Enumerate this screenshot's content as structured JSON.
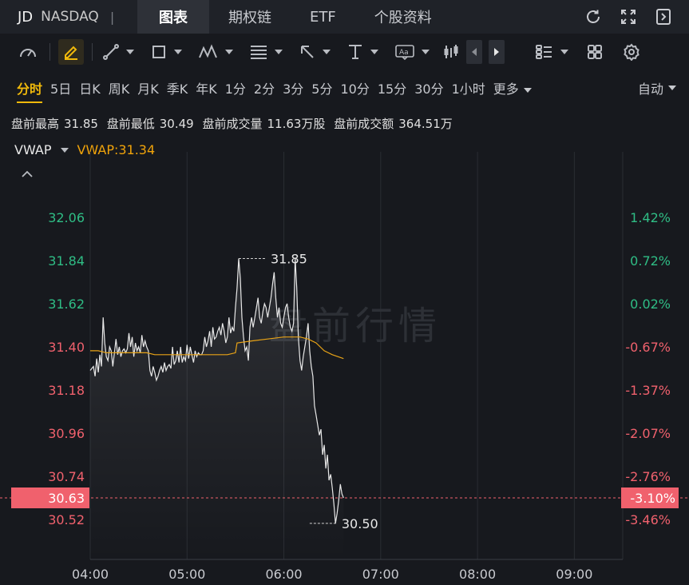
{
  "ticker": {
    "symbol": "JD",
    "exchange": "NASDAQ",
    "separator": "|"
  },
  "tabs": [
    {
      "label": "图表",
      "active": true
    },
    {
      "label": "期权链",
      "active": false
    },
    {
      "label": "ETF",
      "active": false
    },
    {
      "label": "个股资料",
      "active": false
    }
  ],
  "top_icons": [
    "refresh-icon",
    "fullscreen-icon",
    "collapse-panel-icon"
  ],
  "toolbar_icons": [
    "gauge-icon",
    "draw-pencil-icon",
    "trend-line-icon",
    "rectangle-icon",
    "pattern-icon",
    "fibonacci-icon",
    "arrow-icon",
    "measure-icon",
    "text-annotation-icon",
    "candlestick-icon",
    "prev-arrow-icon",
    "next-arrow-icon",
    "layout-list-icon",
    "grid-icon",
    "settings-icon"
  ],
  "periods": [
    {
      "label": "分时",
      "active": true
    },
    {
      "label": "5日"
    },
    {
      "label": "日K"
    },
    {
      "label": "周K"
    },
    {
      "label": "月K"
    },
    {
      "label": "季K"
    },
    {
      "label": "年K"
    },
    {
      "label": "1分"
    },
    {
      "label": "2分"
    },
    {
      "label": "3分"
    },
    {
      "label": "5分"
    },
    {
      "label": "10分"
    },
    {
      "label": "15分"
    },
    {
      "label": "30分"
    },
    {
      "label": "1小时"
    }
  ],
  "more_label": "更多",
  "auto_label": "自动",
  "stats": {
    "high_label": "盘前最高",
    "high": "31.85",
    "low_label": "盘前最低",
    "low": "30.49",
    "volume_label": "盘前成交量",
    "volume": "11.63万股",
    "turnover_label": "盘前成交额",
    "turnover": "364.51万"
  },
  "vwap": {
    "name": "VWAP",
    "value_text": "VWAP:31.34"
  },
  "colors": {
    "up": "#2fbd85",
    "down": "#f0616d",
    "vwap": "#e8a317",
    "accent": "#f0b90b",
    "price_tag": "#f0616d"
  },
  "chart_data": {
    "type": "line",
    "watermark": "盘前行情",
    "x_ticks": [
      "04:00",
      "05:00",
      "06:00",
      "07:00",
      "08:00",
      "09:00"
    ],
    "x_range_minutes": [
      0,
      330
    ],
    "y_left_ticks": [
      "32.06",
      "31.84",
      "31.62",
      "31.40",
      "31.18",
      "30.96",
      "30.74",
      "30.52"
    ],
    "y_right_ticks": [
      "1.42%",
      "0.72%",
      "0.02%",
      "-0.67%",
      "-1.37%",
      "-2.07%",
      "-2.76%",
      "-3.46%"
    ],
    "ylim": [
      30.52,
      32.06
    ],
    "current_price": "30.63",
    "current_pct": "-3.10%",
    "high_label": "31.85",
    "low_label": "30.50",
    "high_point": {
      "x": 92,
      "y": 31.85
    },
    "low_point": {
      "x": 136,
      "y": 30.5
    },
    "series": [
      {
        "role": "price",
        "points": [
          [
            0,
            31.28
          ],
          [
            2,
            31.3
          ],
          [
            3,
            31.25
          ],
          [
            4,
            31.34
          ],
          [
            5,
            31.27
          ],
          [
            6,
            31.36
          ],
          [
            7,
            31.3
          ],
          [
            8,
            31.55
          ],
          [
            9,
            31.42
          ],
          [
            10,
            31.35
          ],
          [
            11,
            31.33
          ],
          [
            12,
            31.4
          ],
          [
            13,
            31.38
          ],
          [
            14,
            31.3
          ],
          [
            15,
            31.37
          ],
          [
            16,
            31.44
          ],
          [
            17,
            31.36
          ],
          [
            18,
            31.4
          ],
          [
            19,
            31.35
          ],
          [
            20,
            31.38
          ],
          [
            21,
            31.39
          ],
          [
            22,
            31.37
          ],
          [
            23,
            31.39
          ],
          [
            24,
            31.47
          ],
          [
            25,
            31.4
          ],
          [
            26,
            31.45
          ],
          [
            27,
            31.35
          ],
          [
            28,
            31.42
          ],
          [
            29,
            31.38
          ],
          [
            30,
            31.4
          ],
          [
            31,
            31.37
          ],
          [
            32,
            31.46
          ],
          [
            33,
            31.4
          ],
          [
            34,
            31.43
          ],
          [
            35,
            31.4
          ],
          [
            36,
            31.38
          ],
          [
            37,
            31.28
          ],
          [
            38,
            31.25
          ],
          [
            39,
            31.3
          ],
          [
            40,
            31.27
          ],
          [
            41,
            31.23
          ],
          [
            42,
            31.25
          ],
          [
            43,
            31.28
          ],
          [
            44,
            31.3
          ],
          [
            45,
            31.27
          ],
          [
            46,
            31.32
          ],
          [
            47,
            31.28
          ],
          [
            48,
            31.3
          ],
          [
            49,
            31.31
          ],
          [
            50,
            31.29
          ],
          [
            51,
            31.4
          ],
          [
            52,
            31.31
          ],
          [
            53,
            31.33
          ],
          [
            54,
            31.38
          ],
          [
            55,
            31.32
          ],
          [
            56,
            31.4
          ],
          [
            57,
            31.32
          ],
          [
            58,
            31.35
          ],
          [
            59,
            31.33
          ],
          [
            60,
            31.41
          ],
          [
            61,
            31.34
          ],
          [
            62,
            31.4
          ],
          [
            63,
            31.36
          ],
          [
            64,
            31.32
          ],
          [
            65,
            31.38
          ],
          [
            66,
            31.35
          ],
          [
            67,
            31.37
          ],
          [
            68,
            31.36
          ],
          [
            69,
            31.36
          ],
          [
            70,
            31.38
          ],
          [
            71,
            31.45
          ],
          [
            72,
            31.4
          ],
          [
            73,
            31.43
          ],
          [
            74,
            31.48
          ],
          [
            75,
            31.4
          ],
          [
            76,
            31.5
          ],
          [
            77,
            31.44
          ],
          [
            78,
            31.45
          ],
          [
            79,
            31.48
          ],
          [
            80,
            31.5
          ],
          [
            81,
            31.46
          ],
          [
            82,
            31.52
          ],
          [
            83,
            31.48
          ],
          [
            84,
            31.42
          ],
          [
            85,
            31.45
          ],
          [
            86,
            31.55
          ],
          [
            87,
            31.47
          ],
          [
            88,
            31.5
          ],
          [
            89,
            31.48
          ],
          [
            90,
            31.6
          ],
          [
            91,
            31.7
          ],
          [
            92,
            31.85
          ],
          [
            93,
            31.75
          ],
          [
            94,
            31.55
          ],
          [
            95,
            31.45
          ],
          [
            96,
            31.38
          ],
          [
            97,
            31.4
          ],
          [
            98,
            31.33
          ],
          [
            99,
            31.5
          ],
          [
            100,
            31.55
          ],
          [
            101,
            31.5
          ],
          [
            102,
            31.55
          ],
          [
            103,
            31.6
          ],
          [
            104,
            31.65
          ],
          [
            105,
            31.55
          ],
          [
            106,
            31.52
          ],
          [
            107,
            31.58
          ],
          [
            108,
            31.62
          ],
          [
            109,
            31.6
          ],
          [
            110,
            31.55
          ],
          [
            111,
            31.6
          ],
          [
            112,
            31.65
          ],
          [
            113,
            31.72
          ],
          [
            114,
            31.78
          ],
          [
            115,
            31.65
          ],
          [
            116,
            31.55
          ],
          [
            117,
            31.6
          ],
          [
            118,
            31.52
          ],
          [
            119,
            31.5
          ],
          [
            120,
            31.55
          ],
          [
            121,
            31.6
          ],
          [
            122,
            31.62
          ],
          [
            123,
            31.55
          ],
          [
            124,
            31.5
          ],
          [
            125,
            31.48
          ],
          [
            126,
            31.52
          ],
          [
            127,
            31.85
          ],
          [
            128,
            31.7
          ],
          [
            129,
            31.45
          ],
          [
            130,
            31.33
          ],
          [
            131,
            31.28
          ],
          [
            132,
            31.35
          ],
          [
            133,
            31.4
          ],
          [
            134,
            31.45
          ],
          [
            135,
            31.52
          ],
          [
            136,
            31.38
          ],
          [
            137,
            31.3
          ],
          [
            138,
            31.25
          ],
          [
            139,
            31.1
          ],
          [
            140,
            31.05
          ],
          [
            141,
            31.0
          ],
          [
            142,
            30.95
          ],
          [
            143,
            30.98
          ],
          [
            144,
            30.85
          ],
          [
            145,
            30.9
          ],
          [
            146,
            30.78
          ],
          [
            147,
            30.85
          ],
          [
            148,
            30.72
          ],
          [
            149,
            30.75
          ],
          [
            150,
            30.68
          ],
          [
            151,
            30.6
          ],
          [
            152,
            30.5
          ],
          [
            153,
            30.55
          ],
          [
            154,
            30.62
          ],
          [
            155,
            30.7
          ],
          [
            156,
            30.65
          ],
          [
            157,
            30.63
          ]
        ]
      },
      {
        "role": "vwap",
        "points": [
          [
            0,
            31.38
          ],
          [
            5,
            31.38
          ],
          [
            10,
            31.37
          ],
          [
            15,
            31.37
          ],
          [
            20,
            31.37
          ],
          [
            25,
            31.37
          ],
          [
            30,
            31.37
          ],
          [
            35,
            31.37
          ],
          [
            40,
            31.36
          ],
          [
            45,
            31.36
          ],
          [
            50,
            31.36
          ],
          [
            55,
            31.36
          ],
          [
            60,
            31.36
          ],
          [
            65,
            31.36
          ],
          [
            70,
            31.36
          ],
          [
            75,
            31.36
          ],
          [
            80,
            31.36
          ],
          [
            85,
            31.36
          ],
          [
            90,
            31.37
          ],
          [
            91,
            31.42
          ],
          [
            100,
            31.43
          ],
          [
            110,
            31.44
          ],
          [
            120,
            31.45
          ],
          [
            125,
            31.45
          ],
          [
            130,
            31.45
          ],
          [
            135,
            31.44
          ],
          [
            140,
            31.42
          ],
          [
            145,
            31.38
          ],
          [
            150,
            31.36
          ],
          [
            157,
            31.34
          ]
        ]
      }
    ]
  }
}
